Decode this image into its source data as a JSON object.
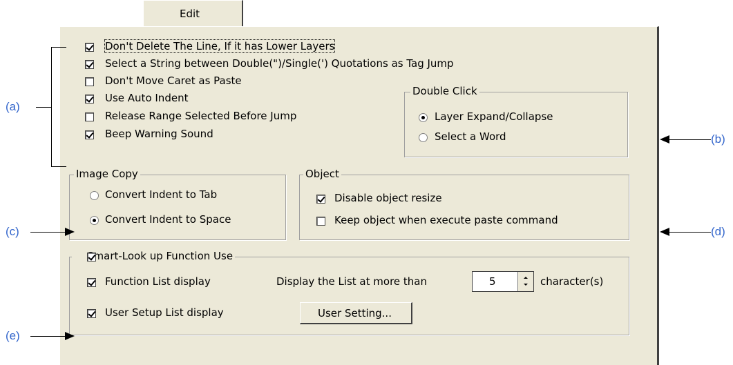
{
  "tab": {
    "label": "Edit"
  },
  "options": [
    {
      "label": "Don't Delete The Line, If it has Lower Layers",
      "checked": true
    },
    {
      "label": "Select a String between Double(\")/Single(') Quotations as Tag Jump",
      "checked": true
    },
    {
      "label": "Don't Move Caret as Paste",
      "checked": false
    },
    {
      "label": "Use Auto Indent",
      "checked": true
    },
    {
      "label": "Release Range Selected Before Jump",
      "checked": false
    },
    {
      "label": "Beep Warning Sound",
      "checked": true
    }
  ],
  "double_click": {
    "title": "Double Click",
    "options": [
      {
        "label": "Layer Expand/Collapse",
        "selected": true
      },
      {
        "label": "Select a Word",
        "selected": false
      }
    ]
  },
  "image_copy": {
    "title": "Image Copy",
    "options": [
      {
        "label": "Convert Indent to Tab",
        "selected": false
      },
      {
        "label": "Convert Indent to Space",
        "selected": true
      }
    ]
  },
  "object": {
    "title": "Object",
    "options": [
      {
        "label": "Disable object resize",
        "checked": true
      },
      {
        "label": "Keep object when execute paste command",
        "checked": false
      }
    ]
  },
  "smart_lookup": {
    "title": "Smart-Look up Function Use",
    "checked": true,
    "function_list": {
      "label": "Function List display",
      "checked": true
    },
    "display_list_label": "Display the List at more than",
    "chars_value": "5",
    "chars_suffix": "character(s)",
    "user_setup": {
      "label": "User Setup List display",
      "checked": true
    },
    "user_setting_button": "User Setting..."
  },
  "annotations": {
    "a": "(a)",
    "b": "(b)",
    "c": "(c)",
    "d": "(d)",
    "e": "(e)"
  }
}
